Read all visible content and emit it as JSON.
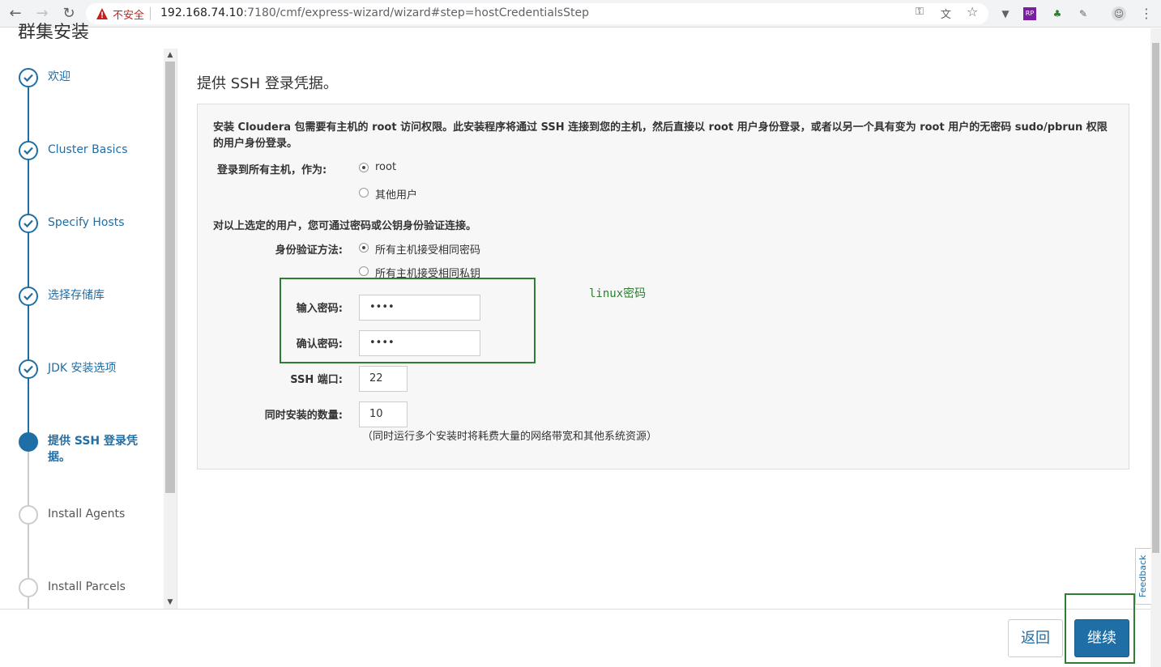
{
  "browser": {
    "security_label": "不安全",
    "url_host": "192.168.74.10",
    "url_path": ":7180/cmf/express-wizard/wizard#step=hostCredentialsStep"
  },
  "page_title": "群集安装",
  "steps": [
    {
      "label": "欢迎",
      "state": "done"
    },
    {
      "label": "Cluster Basics",
      "state": "done"
    },
    {
      "label": "Specify Hosts",
      "state": "done"
    },
    {
      "label": "选择存储库",
      "state": "done"
    },
    {
      "label": "JDK 安装选项",
      "state": "done"
    },
    {
      "label": "提供 SSH 登录凭据。",
      "state": "active"
    },
    {
      "label": "Install Agents",
      "state": "pending"
    },
    {
      "label": "Install Parcels",
      "state": "pending"
    }
  ],
  "main": {
    "title": "提供 SSH 登录凭据。",
    "intro": "安装 Cloudera 包需要有主机的 root 访问权限。此安装程序将通过 SSH 连接到您的主机，然后直接以 root 用户身份登录，或者以另一个具有变为 root 用户的无密码 sudo/pbrun 权限的用户身份登录。",
    "login_label": "登录到所有主机，作为:",
    "login_options": [
      "root",
      "其他用户"
    ],
    "auth_note": "对以上选定的用户，您可通过密码或公钥身份验证连接。",
    "auth_label": "身份验证方法:",
    "auth_options": [
      "所有主机接受相同密码",
      "所有主机接受相同私钥"
    ],
    "password_label": "输入密码:",
    "password_value": "••••",
    "confirm_label": "确认密码:",
    "confirm_value": "••••",
    "ssh_port_label": "SSH 端口:",
    "ssh_port_value": "22",
    "concurrent_label": "同时安装的数量:",
    "concurrent_value": "10",
    "concurrent_hint": "（同时运行多个安装时将耗费大量的网络带宽和其他系统资源）"
  },
  "annotation": {
    "text": "linux密码",
    "color": "#2e7d32"
  },
  "feedback_label": "Feedback",
  "footer": {
    "back_label": "返回",
    "continue_label": "继续"
  },
  "colors": {
    "accent": "#1f6ea6",
    "warning": "#c5221f"
  }
}
